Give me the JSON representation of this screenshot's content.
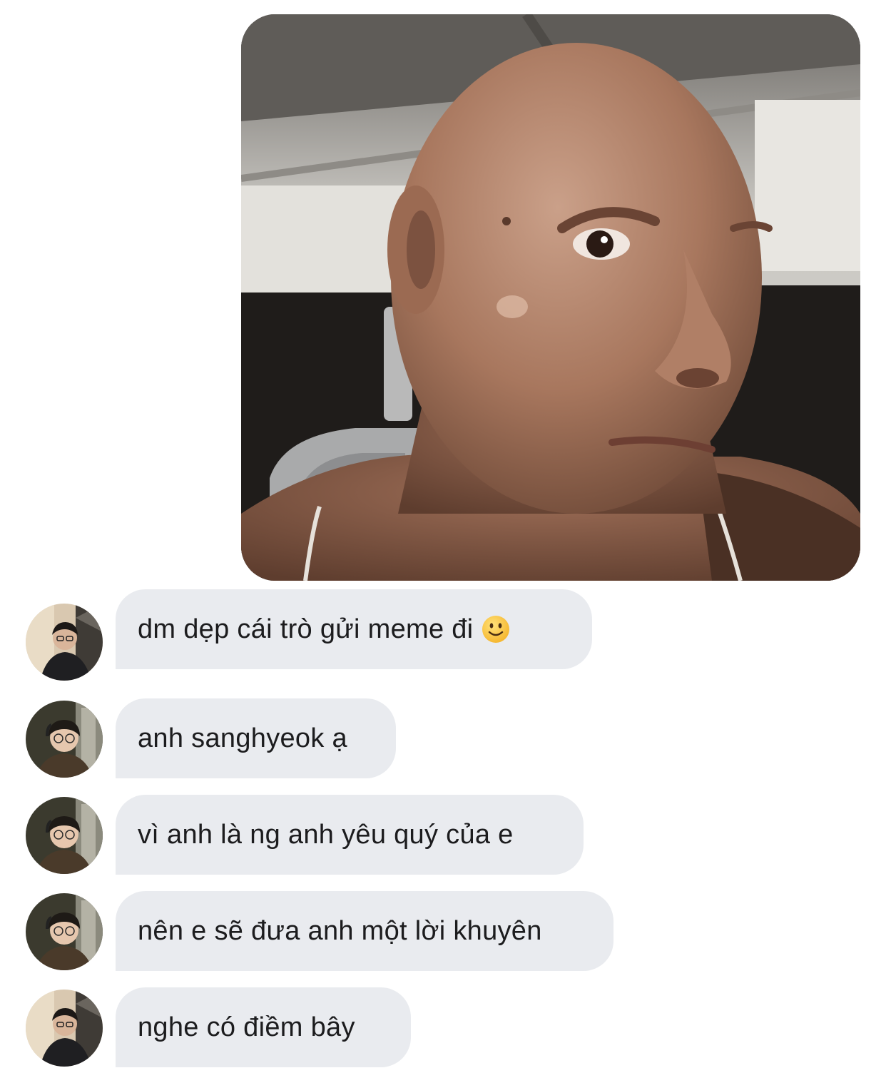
{
  "thread": {
    "sent_photo": {
      "subject": "selfie-photo"
    },
    "messages": [
      {
        "text": "dm dẹp cái trò gửi meme đi",
        "emoji": "slightly-smiling-face-emoji",
        "avatar": "avatar-a"
      },
      {
        "text": "anh sanghyeok ạ",
        "avatar": "avatar-b"
      },
      {
        "text": "vì anh là ng anh yêu quý của e",
        "avatar": "avatar-b"
      },
      {
        "text": "nên e sẽ đưa anh một lời khuyên",
        "avatar": "avatar-b"
      },
      {
        "text": "nghe có điềm bây",
        "avatar": "avatar-a"
      }
    ]
  },
  "colors": {
    "background": "#ffffff",
    "bubble": "#e9ebef",
    "text": "#1c1c1e"
  }
}
